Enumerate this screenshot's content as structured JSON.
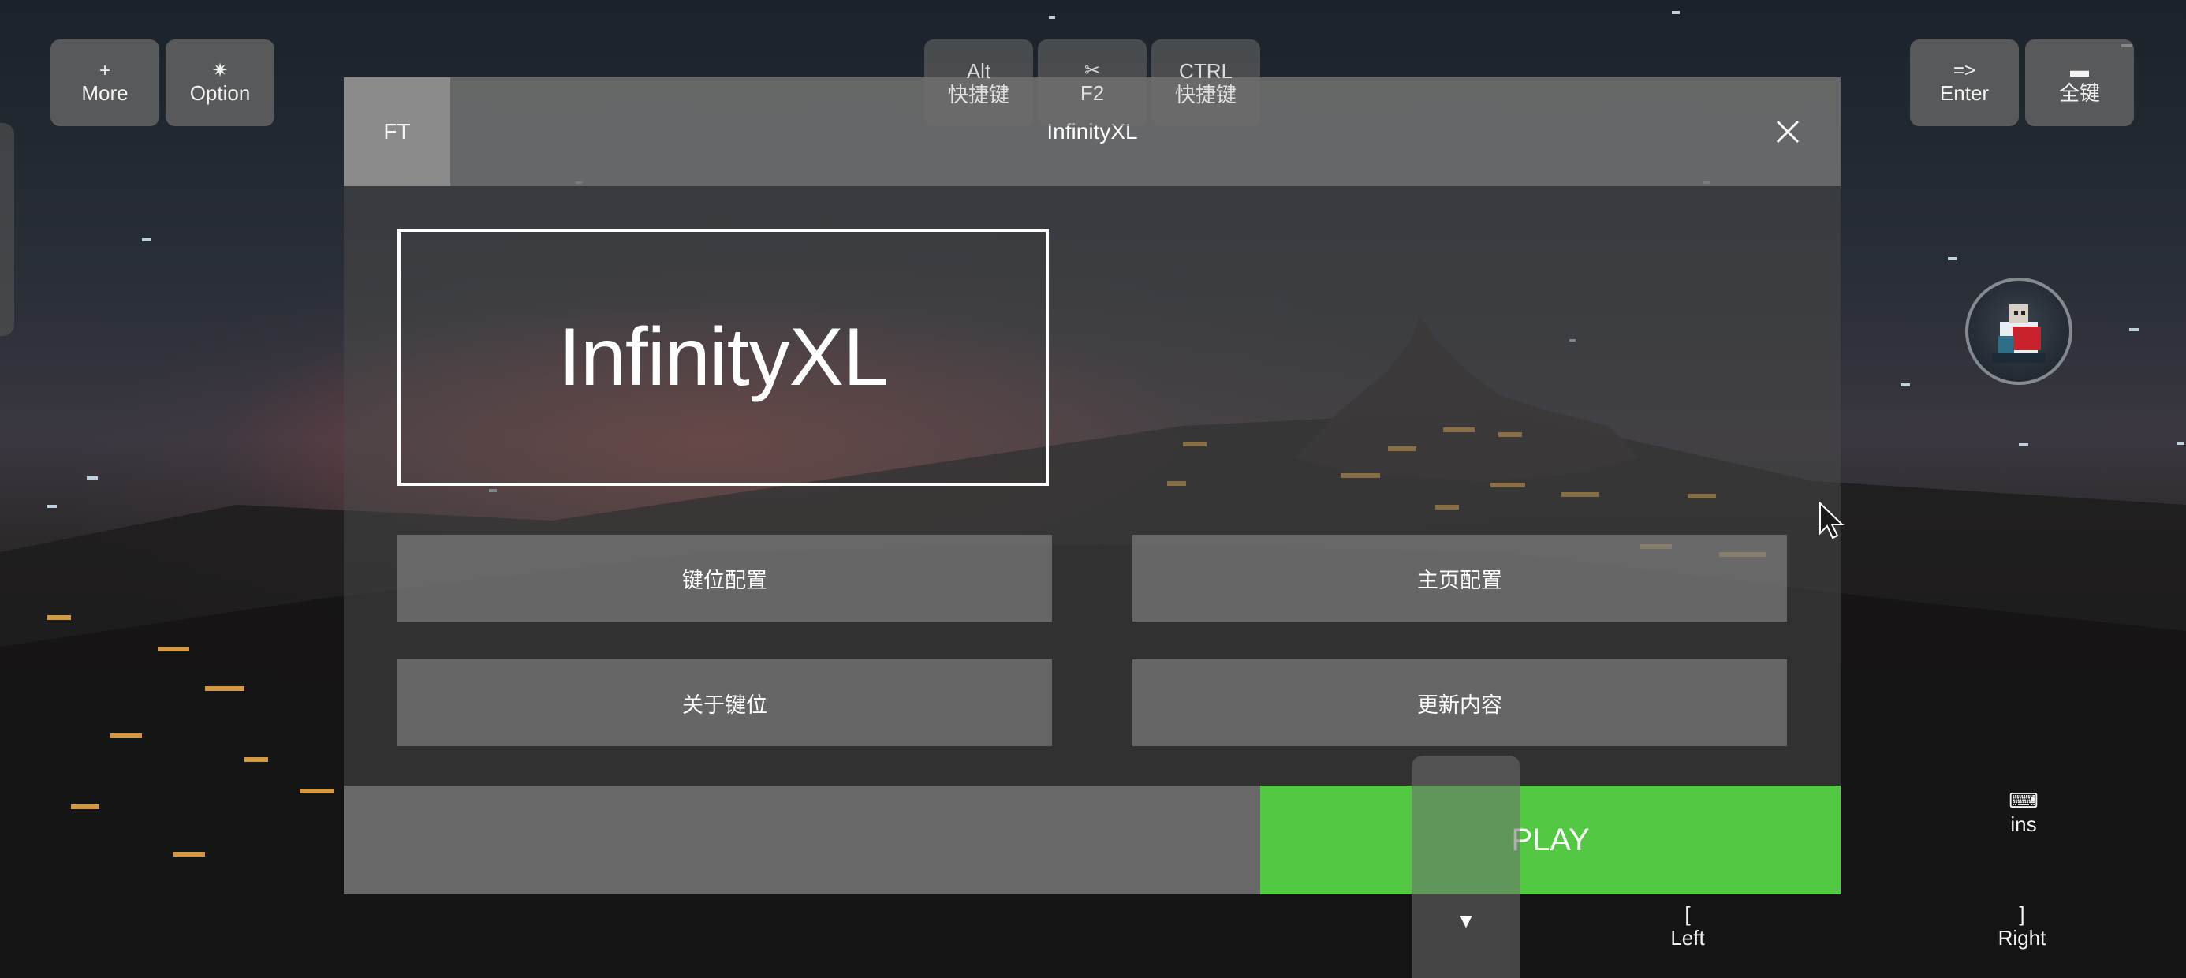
{
  "top_left_keys": [
    {
      "symbol": "+",
      "label": "More"
    },
    {
      "symbol": "✷",
      "label": "Option"
    }
  ],
  "top_center_keys": [
    {
      "line1": "Alt",
      "line2": "快捷键"
    },
    {
      "symbol": "✂",
      "line2": "F2"
    },
    {
      "line1": "CTRL",
      "line2": "快捷键"
    }
  ],
  "top_right_keys": [
    {
      "line1": "=>",
      "line2": "Enter"
    },
    {
      "line1": "▬",
      "line2": "全键"
    }
  ],
  "dialog": {
    "tab_label": "FT",
    "title": "InfinityXL",
    "logo_text": "InfinityXL",
    "buttons": {
      "key_config": "键位配置",
      "home_config": "主页配置",
      "about_keys": "关于键位",
      "update_content": "更新内容"
    },
    "play_label": "PLAY"
  },
  "side_keys": {
    "ins": {
      "icon": "⌨",
      "label": "ins"
    },
    "left": {
      "line1": "[",
      "line2": "Left"
    },
    "right": {
      "line1": "]",
      "line2": "Right"
    },
    "down_arrow": "▼"
  },
  "colors": {
    "play_green": "#52c843",
    "panel_gray": "#787878"
  }
}
